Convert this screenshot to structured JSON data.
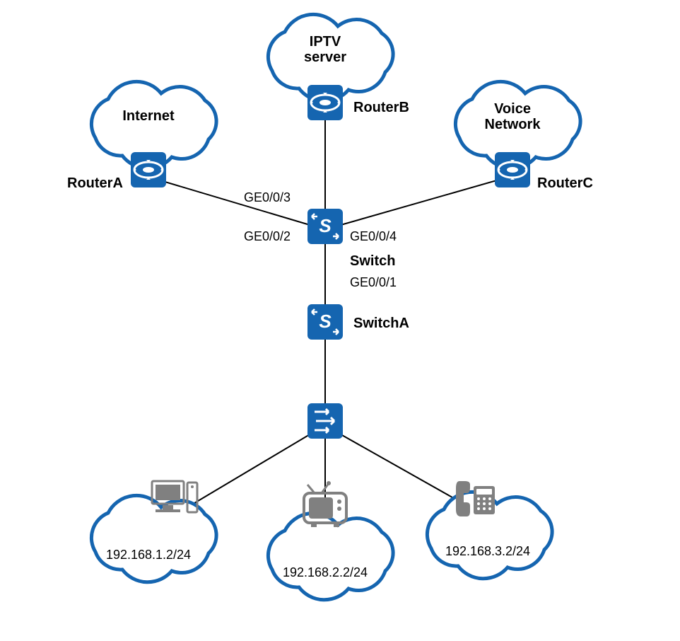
{
  "clouds": {
    "internet": {
      "label": "Internet"
    },
    "iptv": {
      "label1": "IPTV",
      "label2": "server"
    },
    "voice": {
      "label1": "Voice",
      "label2": "Network"
    }
  },
  "routers": {
    "a": {
      "label": "RouterA"
    },
    "b": {
      "label": "RouterB"
    },
    "c": {
      "label": "RouterC"
    }
  },
  "switches": {
    "main": {
      "label": "Switch",
      "ports": {
        "p1": "GE0/0/1",
        "p2": "GE0/0/2",
        "p3": "GE0/0/3",
        "p4": "GE0/0/4"
      }
    },
    "a": {
      "label": "SwitchA"
    }
  },
  "hosts": {
    "pc": {
      "ip": "192.168.1.2/24"
    },
    "tv": {
      "ip": "192.168.2.2/24"
    },
    "phone": {
      "ip": "192.168.3.2/24"
    }
  },
  "colors": {
    "brand": "#1565b0",
    "icon_gray": "#808080"
  }
}
